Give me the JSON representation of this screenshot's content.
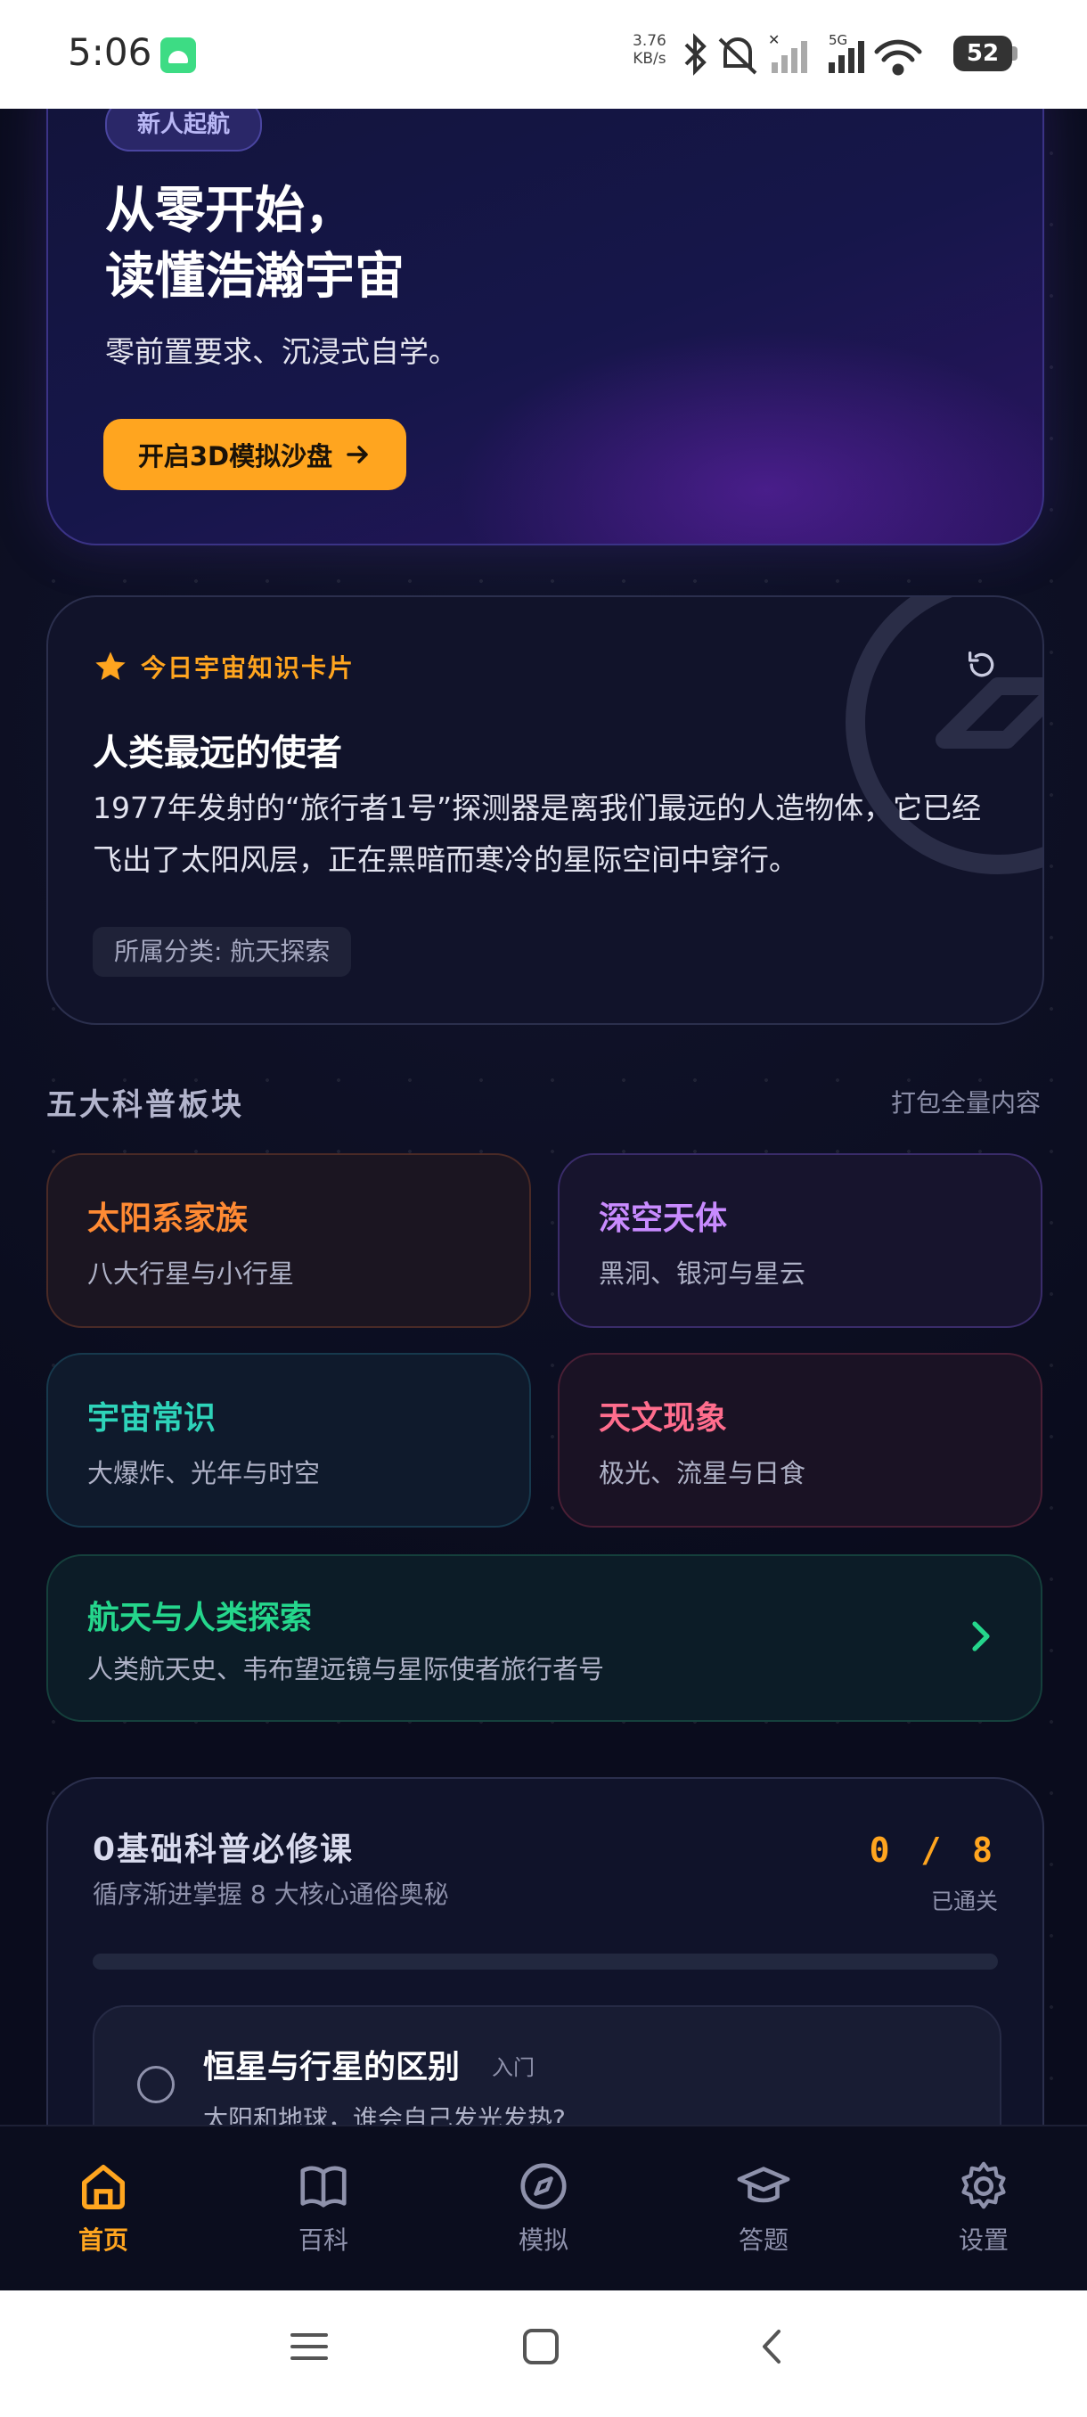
{
  "status_bar": {
    "time": "5:06",
    "net_speed_value": "3.76",
    "net_speed_unit": "KB/s",
    "network": "5G",
    "battery": "52"
  },
  "hero": {
    "badge": "新人起航",
    "title": "从零开始，\n读懂浩瀚宇宙",
    "subtitle": "零前置要求、沉浸式自学。",
    "button_label": "开启3D模拟沙盘"
  },
  "knowledge_card": {
    "header": "今日宇宙知识卡片",
    "title": "人类最远的使者",
    "body": "1977年发射的“旅行者1号”探测器是离我们最远的人造物体，它已经飞出了太阳风层，正在黑暗而寒冷的星际空间中穿行。",
    "category": "所属分类: 航天探索"
  },
  "sections": {
    "title": "五大科普板块",
    "link": "打包全量内容",
    "tiles": [
      {
        "title": "太阳系家族",
        "subtitle": "八大行星与小行星"
      },
      {
        "title": "深空天体",
        "subtitle": "黑洞、银河与星云"
      },
      {
        "title": "宇宙常识",
        "subtitle": "大爆炸、光年与时空"
      },
      {
        "title": "天文现象",
        "subtitle": "极光、流星与日食"
      },
      {
        "title": "航天与人类探索",
        "subtitle": "人类航天史、韦布望远镜与星际使者旅行者号"
      }
    ]
  },
  "course": {
    "title": "0基础科普必修课",
    "subtitle": "循序渐进掌握 8 大核心通俗奥秘",
    "count": "0 / 8",
    "count_label": "已通关",
    "progress": 0,
    "lesson": {
      "title": "恒星与行星的区别",
      "tag": "入门",
      "subtitle": "太阳和地球，谁会自己发光发热?"
    }
  },
  "bottom_nav": [
    {
      "label": "首页",
      "icon": "home-icon",
      "active": true
    },
    {
      "label": "百科",
      "icon": "book-icon",
      "active": false
    },
    {
      "label": "模拟",
      "icon": "compass-icon",
      "active": false
    },
    {
      "label": "答题",
      "icon": "graduation-cap-icon",
      "active": false
    },
    {
      "label": "设置",
      "icon": "gear-icon",
      "active": false
    }
  ],
  "colors": {
    "accent": "#ffa51f",
    "background": "#0a0c1d",
    "solar": "#ff8a33",
    "deep_space": "#c98bff",
    "cosmos": "#2ed3b9",
    "phenomena": "#ff6d8d",
    "exploration": "#25d68c"
  }
}
